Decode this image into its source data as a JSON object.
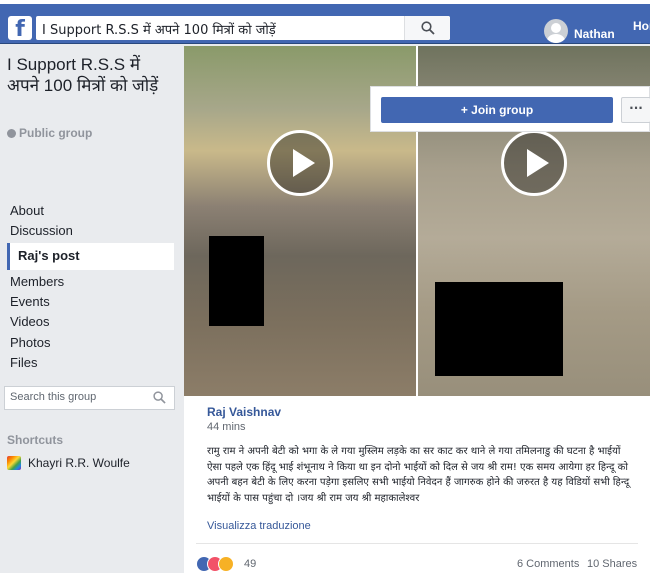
{
  "topbar": {
    "logo": "f",
    "search_value": "I Support R.S.S में अपने 100 मित्रों को जोड़ें",
    "user_name": "Nathan",
    "home_label": "Hom"
  },
  "group": {
    "title": "I Support R.S.S में अपने 100 मित्रों को जोड़ें",
    "privacy": "Public group",
    "join_label": "+ Join group",
    "more_label": "···"
  },
  "sidebar": {
    "items": [
      {
        "label": "About"
      },
      {
        "label": "Discussion"
      },
      {
        "label": "Raj's post"
      },
      {
        "label": "Members"
      },
      {
        "label": "Events"
      },
      {
        "label": "Videos"
      },
      {
        "label": "Photos"
      },
      {
        "label": "Files"
      }
    ],
    "search_placeholder": "Search this group",
    "shortcuts_label": "Shortcuts",
    "shortcut_name": "Khayri R.R. Woulfe"
  },
  "post": {
    "author": "Raj Vaishnav",
    "time": "44 mins",
    "text": "रामु राम ने अपनी बेटी को भगा के ले गया मुस्लिम लड़के का सर काट कर थाने ले गया तमिलनाडु की घटना है भाईयों ऐसा पहले एक हिंदू भाई शंभूनाथ ने किया था इन दोनो भाईयों को दिल से जय श्री राम! एक समय आयेगा हर हिन्दू को अपनी बहन बेटी के लिए करना पड़ेगा इसलिए सभी भाईयो निवेदन हैं जागरुक होने की जरुरत है यह विडियों सभी हिन्दू भाईयों के पास पहुंचा दो ।जय श्री राम जय श्री महाकालेश्वर",
    "translate": "Visualizza traduzione",
    "reaction_count": "49",
    "comments": "6 Comments",
    "shares": "10 Shares"
  },
  "colors": {
    "brand": "#4267b2",
    "link": "#365899",
    "background": "#e9ebee"
  }
}
